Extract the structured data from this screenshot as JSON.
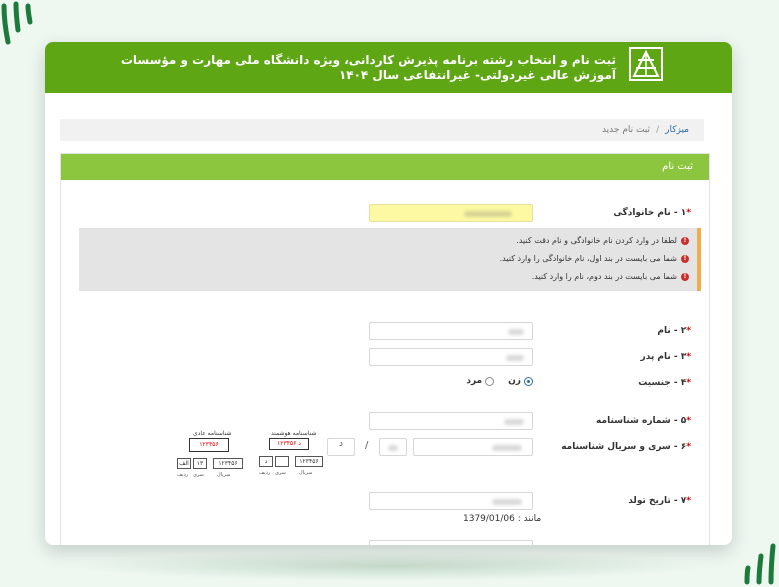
{
  "header": {
    "title_line1": "ثبت نام و انتخاب رشته برنامه پذیرش کاردانی، ویژه دانشگاه ملی مهارت و مؤسسات",
    "title_line2": "آموزش عالی غیردولتی- غیرانتفاعی سال ۱۴۰۴"
  },
  "breadcrumb": {
    "home": "میزکار",
    "separator": "/",
    "current": "ثبت نام جدید"
  },
  "panel": {
    "title": "ثبت نام"
  },
  "fields": {
    "family_name": {
      "label": "۱ - نام خانوادگی",
      "required": "*"
    },
    "first_name": {
      "label": "۲ - نام",
      "required": "*"
    },
    "father_name": {
      "label": "۳ - نام پدر",
      "required": "*"
    },
    "gender": {
      "label": "۴ - جنسیت",
      "required": "*",
      "option_female": "زن",
      "option_male": "مرد"
    },
    "id_number": {
      "label": "۵ - شماره شناسنامه",
      "required": "*"
    },
    "id_serial": {
      "label": "۶ - سری و سریال شناسنامه",
      "required": "*",
      "series_letter": "د",
      "slash": "/"
    },
    "birth_date": {
      "label": "۷ - تاریخ تولد",
      "required": "*",
      "example": "مانند : 1379/01/06"
    }
  },
  "alerts": [
    "لطفا در وارد کردن نام خانوادگی و نام دقت کنید.",
    "شما می بایست در بند اول، نام خانوادگی را وارد کنید.",
    "شما می بایست در بند دوم، نام را وارد کنید."
  ],
  "samples": {
    "smart": {
      "title": "شناسنامه هوشمند",
      "red_code": "۱۲۳۴۵۶ د",
      "serial": "۱۲۳۴۵۶",
      "cell_a": "د",
      "cell_b": "",
      "cap_serial": "سریال",
      "cap_series": "سری",
      "cap_row": "ردیف"
    },
    "regular": {
      "title": "شناسنامه عادی",
      "red_code": "۱۲۳۴۵۶",
      "red_letter": "الف ۱۳",
      "serial": "۱۲۳۴۵۶",
      "cell_a": "۱۳",
      "cell_b": "الف",
      "cap_serial": "سریال",
      "cap_series": "سری",
      "cap_row": "ردیف"
    }
  },
  "colors": {
    "header": "#5ea613",
    "panel_head": "#8cc63f",
    "highlight_input": "#fcf9a2",
    "alert_border": "#f0ad4e"
  }
}
